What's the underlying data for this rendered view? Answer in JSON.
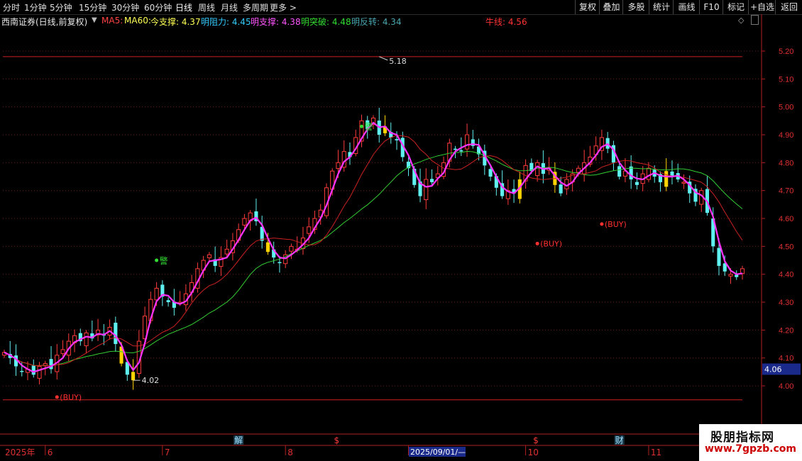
{
  "toolbar": {
    "periods": [
      "分时",
      "1分钟",
      "5分钟",
      "15分钟",
      "30分钟",
      "60分钟",
      "日线",
      "周线",
      "月线",
      "多周期",
      "更多 >"
    ],
    "active": "日线",
    "right_buttons": [
      "复权",
      "叠加",
      "多股",
      "统计",
      "画线",
      "F10",
      "标记",
      "+自选",
      "返回"
    ]
  },
  "legend": {
    "stock": "西南证券(日线,前复权)",
    "ma5": "MA5:",
    "ma60": "MA60:",
    "today_support": "今支撑: 4.37",
    "resistance": "明阻力: 4.45",
    "tomorrow_support": "明支撑: 4.38",
    "breakout": "明突破: 4.48",
    "reversal": "明反转: 4.34",
    "bull_line": "牛线: 4.56"
  },
  "colors": {
    "up": "#ff3b3b",
    "down": "#5ff0f0",
    "signal": "#ffd200",
    "ma5": "#ff33ff",
    "ma_red": "#cc2222",
    "ma_green": "#33cc33",
    "grid": "#6e1a1a",
    "axis": "#b02020",
    "label": "#e03030"
  },
  "chart_data": {
    "type": "candlestick",
    "y_ticks": [
      "5.20",
      "5.10",
      "5.00",
      "4.90",
      "4.80",
      "4.70",
      "4.60",
      "4.50",
      "4.40",
      "4.30",
      "4.20",
      "4.10",
      "4.00"
    ],
    "ylim": [
      3.94,
      5.25
    ],
    "last_price": "4.06",
    "high_label": "5.18",
    "low_label": "4.02",
    "upper_line": 5.18,
    "lower_line": 3.95,
    "x_labels": [
      "2025年",
      "6",
      "7",
      "8",
      "9",
      "10",
      "11"
    ],
    "x_label_index": [
      0,
      7,
      27,
      48,
      69,
      89,
      110
    ],
    "cursor_date": "2025/09/01/—",
    "event_markers": [
      {
        "label": "解",
        "index": 40,
        "color": "#9fe0ff"
      },
      {
        "label": "$",
        "index": 57,
        "color": "#ff3b3b"
      },
      {
        "label": "$",
        "index": 91,
        "color": "#ff3b3b"
      },
      {
        "label": "财",
        "index": 105,
        "color": "#9fe0ff"
      }
    ],
    "buy_signals": [
      {
        "label": "(BUY)",
        "index": 9,
        "price": 3.96
      },
      {
        "label": "(BUY)",
        "index": 91,
        "price": 4.51
      },
      {
        "label": "(BUY)",
        "index": 102,
        "price": 4.58
      }
    ],
    "warn_signals": [
      {
        "label": "警",
        "index": 26,
        "price": 4.45
      },
      {
        "label": "警",
        "index": 61,
        "price": 4.93
      }
    ],
    "closes": [
      4.12,
      4.1,
      4.07,
      4.05,
      4.06,
      4.04,
      4.07,
      4.08,
      4.06,
      4.11,
      4.13,
      4.16,
      4.18,
      4.16,
      4.19,
      4.17,
      4.2,
      4.18,
      4.21,
      4.15,
      4.08,
      4.04,
      4.05,
      4.16,
      4.25,
      4.31,
      4.35,
      4.32,
      4.3,
      4.28,
      4.3,
      4.33,
      4.37,
      4.42,
      4.45,
      4.47,
      4.43,
      4.46,
      4.49,
      4.52,
      4.56,
      4.6,
      4.62,
      4.59,
      4.52,
      4.48,
      4.46,
      4.44,
      4.47,
      4.5,
      4.49,
      4.53,
      4.57,
      4.6,
      4.63,
      4.71,
      4.77,
      4.8,
      4.84,
      4.82,
      4.89,
      4.95,
      4.92,
      4.96,
      4.9,
      4.93,
      4.89,
      4.88,
      4.82,
      4.78,
      4.72,
      4.68,
      4.74,
      4.73,
      4.76,
      4.8,
      4.87,
      4.85,
      4.84,
      4.9,
      4.86,
      4.83,
      4.79,
      4.75,
      4.71,
      4.68,
      4.7,
      4.69,
      4.74,
      4.79,
      4.77,
      4.8,
      4.76,
      4.78,
      4.72,
      4.69,
      4.74,
      4.76,
      4.78,
      4.8,
      4.82,
      4.86,
      4.89,
      4.85,
      4.8,
      4.75,
      4.77,
      4.74,
      4.72,
      4.76,
      4.78,
      4.75,
      4.73,
      4.77,
      4.75,
      4.74,
      4.73,
      4.69,
      4.66,
      4.7,
      4.62,
      4.5,
      4.43,
      4.41,
      4.4,
      4.39,
      4.42
    ]
  }
}
